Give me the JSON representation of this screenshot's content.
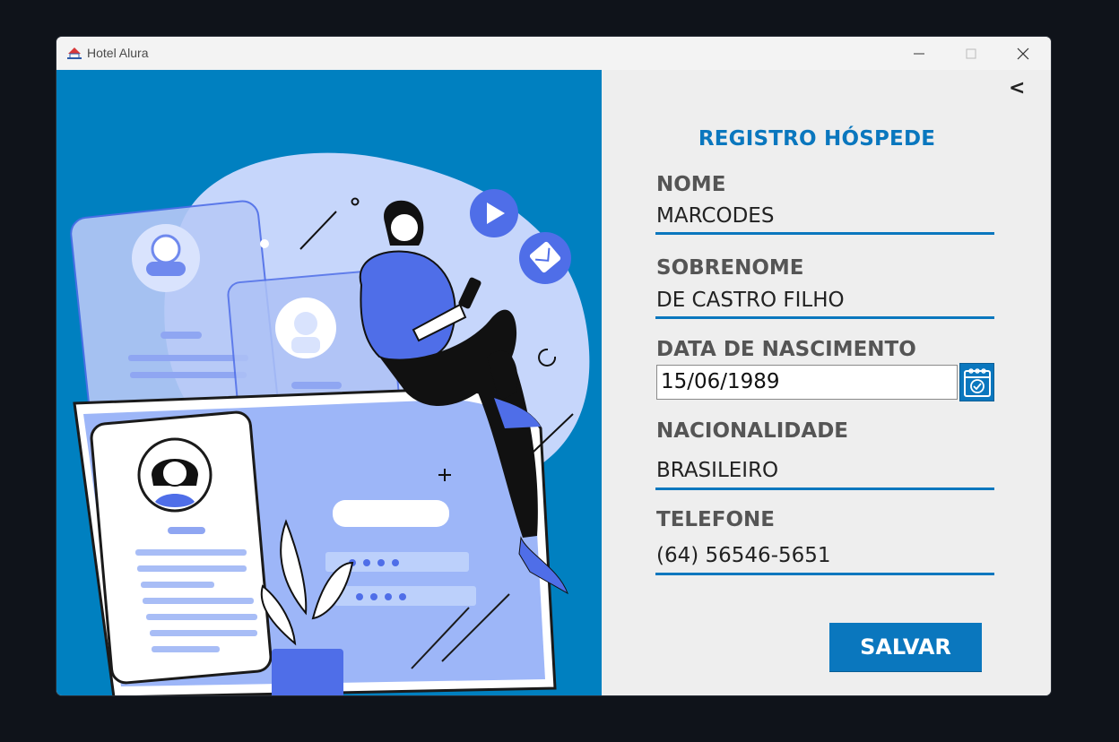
{
  "window": {
    "title": "Hotel Alura",
    "app_icon": "hotel-logo-icon",
    "controls": [
      "minimize-icon",
      "maximize-icon",
      "close-icon"
    ]
  },
  "colors": {
    "accent": "#0a77be",
    "left_panel": "#0080c0",
    "form_background": "#eeeeee",
    "illustration_blue": "#4f6ee8",
    "illustration_light": "#c7d6fb"
  },
  "nav": {
    "back_label": "<"
  },
  "form": {
    "title": "REGISTRO HÓSPEDE",
    "fields": [
      {
        "label": "NOME",
        "value": "MARCODES"
      },
      {
        "label": "SOBRENOME",
        "value": "DE CASTRO FILHO"
      },
      {
        "label": "DATA DE NASCIMENTO",
        "value": "15/06/1989",
        "icon": "calendar-icon"
      },
      {
        "label": "NACIONALIDADE",
        "value": "BRASILEIRO"
      },
      {
        "label": "TELEFONE",
        "value": "(64) 56546-5651"
      }
    ],
    "save_label": "SALVAR"
  }
}
